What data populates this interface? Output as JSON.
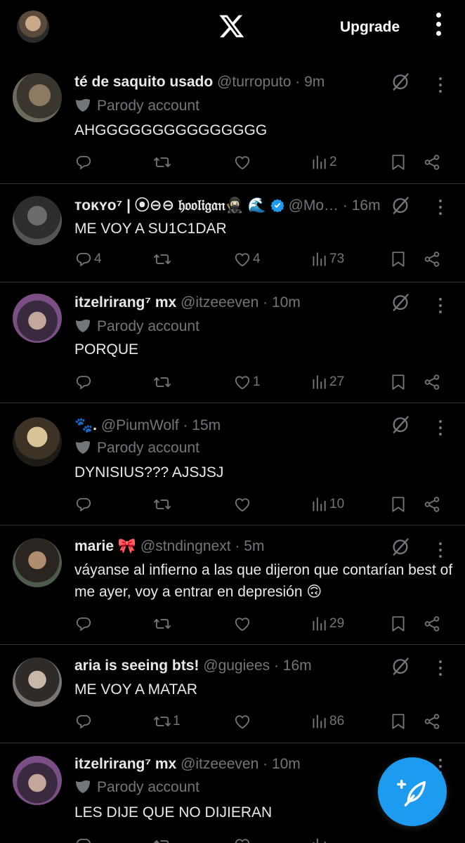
{
  "topbar": {
    "upgrade_label": "Upgrade",
    "logo_icon": "x-logo-icon",
    "more_icon": "vertical-ellipsis-icon"
  },
  "colors": {
    "accent": "#1d9bf0",
    "muted": "#71767b",
    "background": "#000000",
    "divider": "#2f3336"
  },
  "tweets": [
    {
      "name": "té de saquito usado",
      "handle": "@turroputo · 9m",
      "parody": "Parody account",
      "text": "AHGGGGGGGGGGGGGGG",
      "replies": "",
      "reposts": "",
      "likes": "",
      "views": "2"
    },
    {
      "name": "ᴛᴏᴋʏᴏ⁷ | ⦿⊖⊖ 𝔥𝔬𝔬𝔩𝔦𝔤𝔞𝔫🥷🏻 🌊",
      "handle": "@Mo…  · 16m",
      "parody": "",
      "text": "ME VOY A SU1C1DAR",
      "replies": "4",
      "reposts": "",
      "likes": "4",
      "views": "73"
    },
    {
      "name": "itzelrirang⁷ mx",
      "handle": "@itzeeeven · 10m",
      "parody": "Parody account",
      "text": "PORQUE",
      "replies": "",
      "reposts": "",
      "likes": "1",
      "views": "27"
    },
    {
      "name": "🐾.",
      "handle": "@PiumWolf · 15m",
      "parody": "Parody account",
      "text": "DYNISIUS??? AJSJSJ",
      "replies": "",
      "reposts": "",
      "likes": "",
      "views": "10"
    },
    {
      "name": "marie 🎀",
      "handle": "@stndingnext · 5m",
      "parody": "",
      "text": "váyanse al infierno a las que dijeron que contarían best of me ayer, voy a entrar en depresión 🙃",
      "replies": "",
      "reposts": "",
      "likes": "",
      "views": "29"
    },
    {
      "name": "aria is seeing bts!",
      "handle": "@gugiees · 16m",
      "parody": "",
      "text": "ME VOY A MATAR",
      "replies": "",
      "reposts": "1",
      "likes": "",
      "views": "86"
    },
    {
      "name": "itzelrirang⁷ mx",
      "handle": "@itzeeeven · 10m",
      "parody": "Parody account",
      "text": "LES DIJE QUE NO DIJIERAN",
      "replies": "",
      "reposts": "",
      "likes": "",
      "views": ""
    }
  ]
}
